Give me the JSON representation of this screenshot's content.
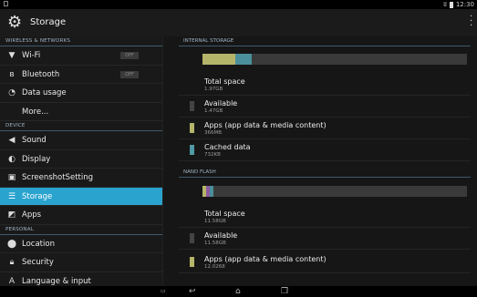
{
  "status_bar": {
    "time": "12:30"
  },
  "app_bar": {
    "title": "Storage"
  },
  "colors": {
    "selected": "#2aa3cf",
    "apps": "#b5b56a",
    "cached": "#4f9aa5",
    "available": "#444444",
    "used_bar": "#4a8f9a"
  },
  "sidebar": {
    "sections": [
      {
        "header": "WIRELESS & NETWORKS",
        "items": [
          {
            "label": "Wi-Fi",
            "icon": "wifi-icon",
            "toggle": "OFF"
          },
          {
            "label": "Bluetooth",
            "icon": "bluetooth-icon",
            "toggle": "OFF"
          },
          {
            "label": "Data usage",
            "icon": "data-usage-icon"
          },
          {
            "label": "More..."
          }
        ]
      },
      {
        "header": "DEVICE",
        "items": [
          {
            "label": "Sound",
            "icon": "speaker-icon"
          },
          {
            "label": "Display",
            "icon": "brightness-icon"
          },
          {
            "label": "ScreenshotSetting",
            "icon": "screenshot-icon"
          },
          {
            "label": "Storage",
            "icon": "storage-icon",
            "selected": true
          },
          {
            "label": "Apps",
            "icon": "apps-icon"
          }
        ]
      },
      {
        "header": "PERSONAL",
        "items": [
          {
            "label": "Location",
            "icon": "location-pin-icon"
          },
          {
            "label": "Security",
            "icon": "lock-icon"
          },
          {
            "label": "Language & input",
            "icon": "keyboard-a-icon"
          }
        ]
      }
    ]
  },
  "internal": {
    "header": "INTERNAL STORAGE",
    "total": {
      "title": "Total space",
      "value": "1.97GB"
    },
    "available": {
      "title": "Available",
      "value": "1.47GB"
    },
    "apps": {
      "title": "Apps (app data & media content)",
      "value": "366MB"
    },
    "cached": {
      "title": "Cached data",
      "value": "732KB"
    }
  },
  "nand": {
    "header": "NAND FLASH",
    "total": {
      "title": "Total space",
      "value": "11.58GB"
    },
    "available": {
      "title": "Available",
      "value": "11.58GB"
    },
    "apps": {
      "title": "Apps (app data & media content)",
      "value": "12.0268"
    }
  }
}
